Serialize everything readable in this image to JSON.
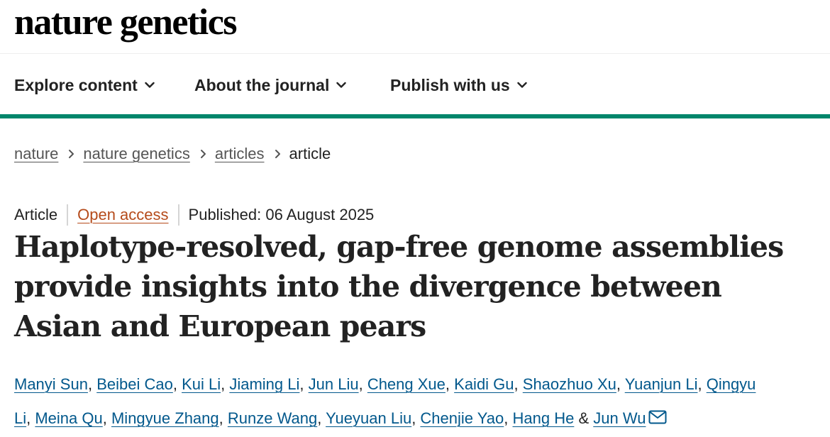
{
  "header": {
    "logo": "nature genetics"
  },
  "nav": {
    "items": [
      {
        "label": "Explore content"
      },
      {
        "label": "About the journal"
      },
      {
        "label": "Publish with us"
      }
    ],
    "accent_color": "#01866b"
  },
  "breadcrumb": {
    "items": [
      "nature",
      "nature genetics",
      "articles"
    ],
    "current": "article"
  },
  "article": {
    "type": "Article",
    "access": "Open access",
    "published": "Published: 06 August 2025",
    "title": "Haplotype-resolved, gap-free genome assemblies provide insights into the divergence between Asian and European pears",
    "authors_line1": [
      "Manyi Sun",
      "Beibei Cao",
      "Kui Li",
      "Jiaming Li",
      "Jun Liu",
      "Cheng Xue",
      "Kaidi Gu",
      "Shaozhuo Xu",
      "Yuanjun Li",
      "Qingyu"
    ],
    "authors_line2": [
      "Li",
      "Meina Qu",
      "Mingyue Zhang",
      "Runze Wang",
      "Yueyuan Liu",
      "Chenjie Yao",
      "Hang He"
    ],
    "authors_last": "Jun Wu",
    "separator": ",",
    "ampersand": "&",
    "link_color": "#02588c",
    "access_color": "#b54b1b"
  }
}
